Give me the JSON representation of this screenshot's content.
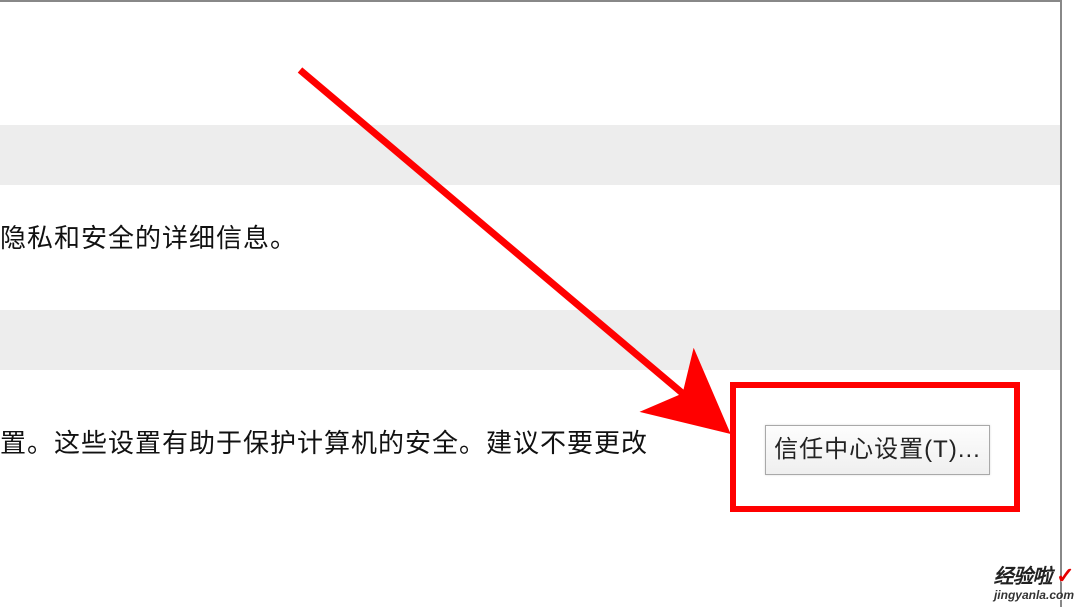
{
  "section1_text": "隐私和安全的详细信息。",
  "section2_text": "置。这些设置有助于保护计算机的安全。建议不要更改",
  "trust_button_label": "信任中心设置(T)...",
  "watermark": {
    "brand": "经验啦",
    "domain": "jingyanla.com"
  }
}
